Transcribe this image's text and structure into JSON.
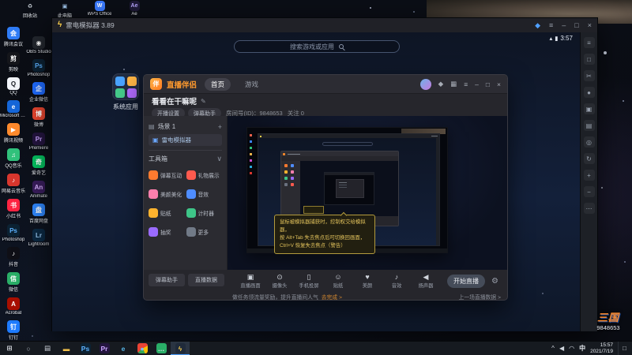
{
  "colors": {
    "accent": "#ff8a2a",
    "tooltip_border": "#b39b3d",
    "active_taskbar_underline": "#4a9eff"
  },
  "desktop": {
    "top_icons": [
      {
        "name": "recycle-bin",
        "label": "回收站",
        "glyph": "♻",
        "fg": "#cfd6de"
      },
      {
        "name": "this-pc",
        "label": "此电脑",
        "glyph": "▣",
        "fg": "#9fc4ea"
      },
      {
        "name": "wps-office",
        "label": "WPS Office",
        "glyph": "W",
        "bg": "#3b7bff"
      },
      {
        "name": "after-effects",
        "label": "Ae",
        "glyph": "Ae",
        "bg": "#1f1a38",
        "fg": "#b8a6ff"
      }
    ],
    "col1": [
      {
        "label": "腾讯会议",
        "glyph": "会",
        "bg": "#2f7cf6"
      },
      {
        "label": "剪映",
        "glyph": "剪",
        "bg": "#15161b"
      },
      {
        "label": "QQ",
        "glyph": "Q",
        "bg": "#f2f5fa",
        "fg": "#14181f"
      },
      {
        "label": "Microsoft Edge",
        "glyph": "e",
        "bg": "#1566d8"
      },
      {
        "label": "腾讯视频",
        "glyph": "▶",
        "bg": "#ff8a2d"
      },
      {
        "label": "QQ音乐",
        "glyph": "♫",
        "bg": "#31c27c"
      },
      {
        "label": "网易云音乐",
        "glyph": "♪",
        "bg": "#d8372e"
      },
      {
        "label": "小红书",
        "glyph": "书",
        "bg": "#ff2442"
      },
      {
        "label": "Photoshop",
        "glyph": "Ps",
        "bg": "#0c2233",
        "fg": "#5eb2ff"
      },
      {
        "label": "抖音",
        "glyph": "♪",
        "bg": "#0f0f16"
      },
      {
        "label": "微信",
        "glyph": "信",
        "bg": "#2aae67"
      },
      {
        "label": "Acrobat",
        "glyph": "A",
        "bg": "#a80f00"
      },
      {
        "label": "钉钉",
        "glyph": "钉",
        "bg": "#1e7bff"
      }
    ],
    "col2": [
      {
        "label": "OBS Studio",
        "glyph": "◉",
        "bg": "#23272e"
      },
      {
        "label": "Photoshop",
        "glyph": "Ps",
        "bg": "#0c2233",
        "fg": "#5eb2ff"
      },
      {
        "label": "企业微信",
        "glyph": "企",
        "bg": "#1f6bff"
      },
      {
        "label": "微博",
        "glyph": "博",
        "bg": "#e6452f"
      },
      {
        "label": "Premiere",
        "glyph": "Pr",
        "bg": "#24153f",
        "fg": "#c9a4ff"
      },
      {
        "label": "爱奇艺",
        "glyph": "奇",
        "bg": "#04c160"
      },
      {
        "label": "Animate",
        "glyph": "An",
        "bg": "#3a1d5d",
        "fg": "#d9b2ff"
      },
      {
        "label": "百度网盘",
        "glyph": "盘",
        "bg": "#2f88ff"
      },
      {
        "label": "Lightroom",
        "glyph": "Lr",
        "bg": "#0c2a44",
        "fg": "#9ecdf5"
      }
    ]
  },
  "taskbar": {
    "icons": [
      {
        "name": "start-button",
        "glyph": "⊞",
        "fg": "#d8dce2"
      },
      {
        "name": "search-button",
        "glyph": "○",
        "fg": "#aeb6c0"
      },
      {
        "name": "task-view-button",
        "glyph": "▤",
        "fg": "#c9ced6"
      },
      {
        "name": "file-explorer",
        "glyph": "▬",
        "fg": "#f2c14b"
      },
      {
        "name": "photoshop",
        "glyph": "Ps",
        "bg": "#0c2233",
        "fg": "#5eb2ff"
      },
      {
        "name": "premiere",
        "glyph": "Pr",
        "bg": "#24153f",
        "fg": "#c9a4ff"
      },
      {
        "name": "edge",
        "glyph": "e",
        "fg": "#57b6e8"
      },
      {
        "name": "chrome",
        "glyph": "●",
        "bg": "conic-gradient(from -45deg,#ea4335 0 30%,#fbbc05 0 55%,#34a853 0 75%,#ea4335 0)",
        "fg": "#7ab8ff"
      },
      {
        "name": "wechat",
        "glyph": "…",
        "bg": "#2aae67"
      },
      {
        "name": "ldplayer",
        "glyph": "ϟ",
        "bg": "#1f2a3a",
        "fg": "#ffd24a"
      }
    ],
    "tray_icons": [
      {
        "name": "tray-caret-icon",
        "glyph": "^"
      },
      {
        "name": "volume-icon",
        "glyph": "◀"
      },
      {
        "name": "network-icon",
        "glyph": "◠"
      }
    ],
    "ime": "中",
    "time": "15:57",
    "date": "2021/7/19",
    "notification_glyph": "□"
  },
  "emulator": {
    "title": "雷电模拟器 3.89",
    "logo_glyph": "ϟ",
    "titlebar_icons": [
      {
        "name": "vip-icon",
        "glyph": "◆"
      },
      {
        "name": "menu-icon",
        "glyph": "≡"
      }
    ],
    "window_controls": [
      {
        "name": "minimize-button",
        "glyph": "–"
      },
      {
        "name": "maximize-button",
        "glyph": "□"
      },
      {
        "name": "close-button",
        "glyph": "×"
      }
    ],
    "status_icons": [
      {
        "name": "signal-icon",
        "glyph": "▴"
      },
      {
        "name": "battery-icon",
        "glyph": "▮"
      }
    ],
    "clock": "3:57",
    "search_placeholder": "搜索游戏或应用",
    "folder_label": "系统应用",
    "sidebar_icons": [
      {
        "name": "menu-icon",
        "glyph": "≡"
      },
      {
        "name": "fullscreen-icon",
        "glyph": "□"
      },
      {
        "name": "screenshot-icon",
        "glyph": "✂"
      },
      {
        "name": "record-icon",
        "glyph": "●"
      },
      {
        "name": "multi-instance-icon",
        "glyph": "▣"
      },
      {
        "name": "keymap-icon",
        "glyph": "▤"
      },
      {
        "name": "location-icon",
        "glyph": "◎"
      },
      {
        "name": "rotate-icon",
        "glyph": "↻"
      },
      {
        "name": "volume-up-icon",
        "glyph": "+"
      },
      {
        "name": "volume-down-icon",
        "glyph": "−"
      },
      {
        "name": "more-icon",
        "glyph": "⋯"
      }
    ]
  },
  "app": {
    "logo_text": "直播伴侣",
    "logo_glyph": "伴",
    "tabs": [
      "首页",
      "游戏"
    ],
    "titlebar_icons": [
      {
        "name": "gift-icon",
        "glyph": "◆"
      },
      {
        "name": "skin-icon",
        "glyph": "▦"
      },
      {
        "name": "menu-icon",
        "glyph": "≡"
      }
    ],
    "window_controls": [
      {
        "name": "minimize-button",
        "glyph": "–"
      },
      {
        "name": "maximize-button",
        "glyph": "□"
      },
      {
        "name": "close-button",
        "glyph": "×"
      }
    ],
    "stream_title": "看看在干嘛呢",
    "room_id": "房间号(ID)：9848653",
    "follows": "关注 0",
    "pills": [
      "开播设置",
      "弹幕助手"
    ],
    "icons": {
      "edit": "✎",
      "scene": "▤",
      "source": "▣",
      "add": "+",
      "collapse": "∨",
      "gear": "⚙"
    },
    "panel": {
      "scene": "场景 1",
      "source": "雷电模拟器",
      "toolbox": "工具箱",
      "tools": [
        {
          "label": "弹幕互动",
          "bg": "#ff7a2f"
        },
        {
          "label": "礼物展示",
          "bg": "#ff5a4e"
        },
        {
          "label": "美颜美化",
          "bg": "#ff7fae"
        },
        {
          "label": "音效",
          "bg": "#4f8dff"
        },
        {
          "label": "贴纸",
          "bg": "#ffb32e"
        },
        {
          "label": "计时器",
          "bg": "#3ec588"
        },
        {
          "label": "抽奖",
          "bg": "#9a6bff"
        },
        {
          "label": "更多",
          "bg": "#717a87"
        }
      ],
      "bottom_buttons": [
        "弹幕助手",
        "直播数据"
      ]
    },
    "tooltip": {
      "lines": [
        "鼠标被模拟器捕获时，控制权交给模拟器，",
        "按 Alt+Tab 失去焦点后可切换回画面，",
        "Ctrl+V 恢复失去焦点（警告）"
      ]
    },
    "toolbar": {
      "items": [
        {
          "glyph": "▣",
          "label": "直播画面"
        },
        {
          "glyph": "⊙",
          "label": "摄像头"
        },
        {
          "glyph": "▯",
          "label": "手机投屏"
        },
        {
          "glyph": "☺",
          "label": "贴纸"
        },
        {
          "glyph": "♥",
          "label": "美颜"
        },
        {
          "glyph": "♪",
          "label": "音效"
        },
        {
          "glyph": "◀",
          "label": "扬声器"
        }
      ],
      "start_button": "开始直播"
    },
    "status_left": "做任务领流量奖励，提升直播间人气",
    "status_link": "去完成 >",
    "status_right": "上一场直播数据 >"
  },
  "watermark": {
    "title": "三国",
    "room": "9848653"
  }
}
